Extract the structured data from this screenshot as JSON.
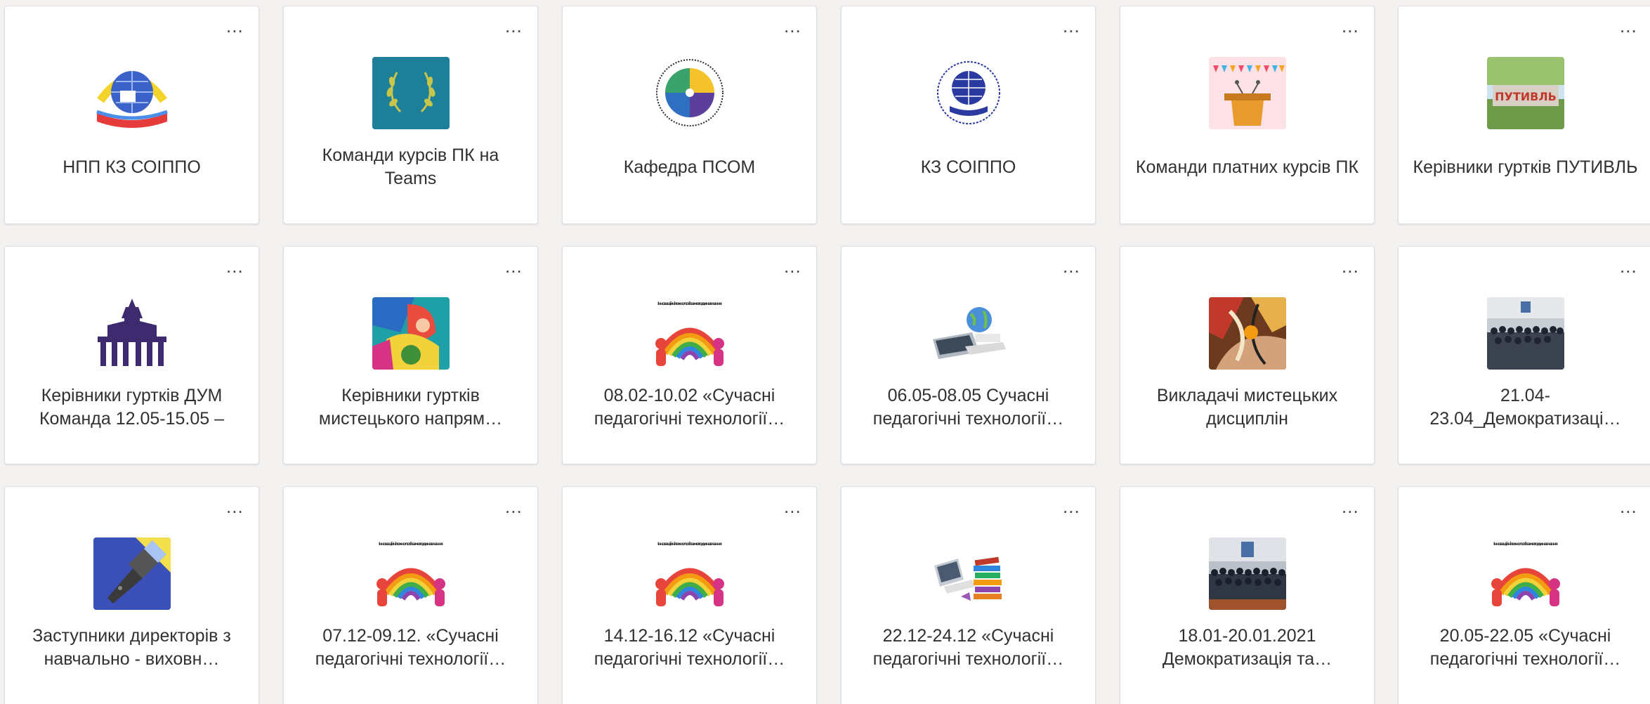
{
  "more_options_label": "...",
  "teams": [
    {
      "title": "НПП КЗ СОІППО",
      "avatar": "institute-globe-logo"
    },
    {
      "title": "Команди курсів ПК на Teams",
      "avatar": "laurel-wreath-logo"
    },
    {
      "title": "Кафедра ПСОМ",
      "avatar": "kafedra-circle-logo"
    },
    {
      "title": "КЗ СОІППО",
      "avatar": "institute-blue-logo"
    },
    {
      "title": "Команди платних курсів ПК",
      "avatar": "podium-bunting-image"
    },
    {
      "title": "Керівники гуртків ПУТИВЛЬ",
      "avatar": "putyvl-sign-photo"
    },
    {
      "title": "Керівники гуртків ДУМ Команда 12.05-15.05 –",
      "avatar": "palace-silhouette-logo"
    },
    {
      "title": "Керівники гуртків мистецького напрям…",
      "avatar": "art-painting-image"
    },
    {
      "title": "08.02-10.02 «Сучасні педагогічні технології…",
      "avatar": "innovation-people-image"
    },
    {
      "title": "06.05-08.05 Сучасні педагогічні технології…",
      "avatar": "globe-laptop-image"
    },
    {
      "title": "Викладачі мистецьких дисциплін",
      "avatar": "abstract-art-image"
    },
    {
      "title": "21.04-23.04_Демократизаці…",
      "avatar": "group-photo"
    },
    {
      "title": "Заступники директорів з навчально - виховн…",
      "avatar": "flashlight-icon"
    },
    {
      "title": "07.12-09.12. «Сучасні педагогічні технології…",
      "avatar": "innovation-people-image"
    },
    {
      "title": "14.12-16.12 «Сучасні педагогічні технології…",
      "avatar": "innovation-people-image"
    },
    {
      "title": "22.12-24.12 «Сучасні педагогічні технології…",
      "avatar": "books-laptop-image"
    },
    {
      "title": "18.01-20.01.2021 Демократизація та…",
      "avatar": "group-photo"
    },
    {
      "title": "20.05-22.05 «Сучасні педагогічні технології…",
      "avatar": "innovation-people-image"
    }
  ],
  "innovation_caption": "Інноваційні технології та методи навчання",
  "putyvl_sign_text": "ПУТИВЛЬ"
}
